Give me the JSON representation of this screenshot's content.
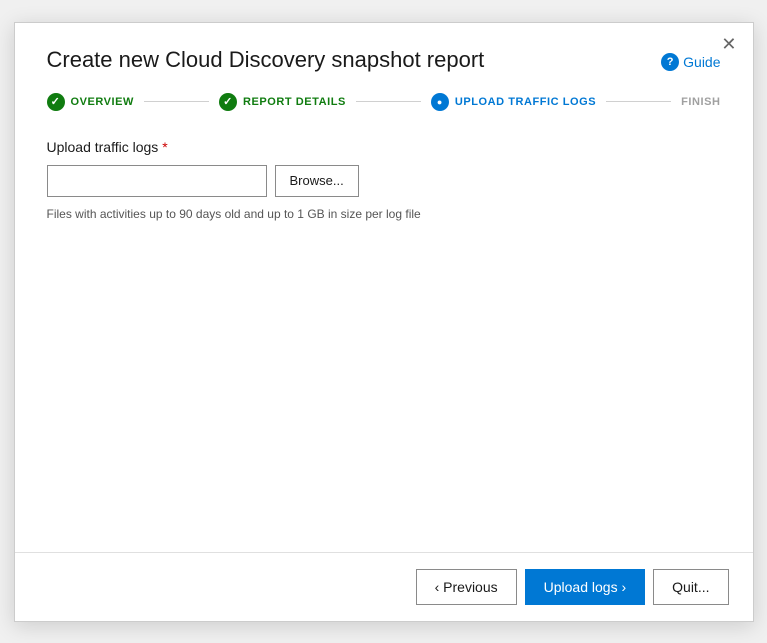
{
  "dialog": {
    "title": "Create new Cloud Discovery snapshot report",
    "close_label": "×",
    "guide_label": "Guide"
  },
  "stepper": {
    "steps": [
      {
        "id": "overview",
        "label": "OVERVIEW",
        "state": "completed"
      },
      {
        "id": "report-details",
        "label": "REPORT DETAILS",
        "state": "completed"
      },
      {
        "id": "upload-traffic-logs",
        "label": "UPLOAD TRAFFIC LOGS",
        "state": "active"
      },
      {
        "id": "finish",
        "label": "FINISH",
        "state": "inactive"
      }
    ]
  },
  "body": {
    "field_label": "Upload traffic logs",
    "required_marker": " *",
    "file_input_placeholder": "",
    "browse_button_label": "Browse...",
    "hint_text": "Files with activities up to 90 days old and up to 1 GB in size per log file"
  },
  "footer": {
    "previous_label": "‹ Previous",
    "upload_label": "Upload logs ›",
    "quit_label": "Quit..."
  },
  "icons": {
    "check": "✓",
    "circle_active": "●",
    "question": "?",
    "close": "✕"
  }
}
